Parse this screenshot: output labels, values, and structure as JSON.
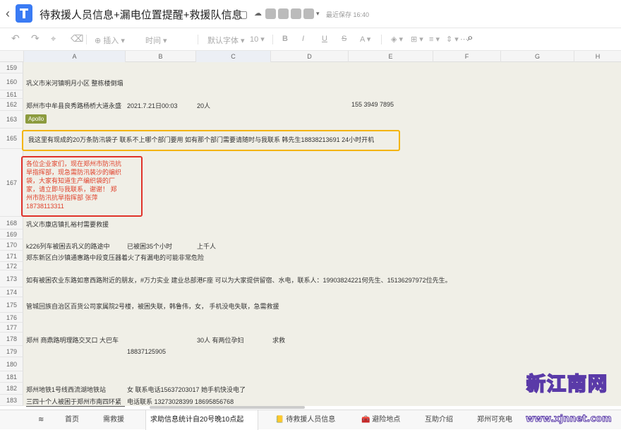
{
  "title": "待救援人员信息+漏电位置提醒+救援队信息",
  "save_status": "最近保存 16:40",
  "toolbar": {
    "undo": "↶",
    "redo": "↷",
    "paint": "⌖",
    "clear": "⌫",
    "insert": "⊕ 插入 ▾",
    "time": "时间 ▾",
    "font": "默认字体 ▾",
    "size": "10 ▾",
    "bold": "B",
    "italic": "I",
    "underline": "U",
    "strike": "S",
    "textcolor": "A ▾",
    "fill": "◈ ▾",
    "border": "⊞ ▾",
    "align": "≡ ▾",
    "valign": "⇕ ▾",
    "more": "⋯",
    "search": "⌕"
  },
  "columns": [
    "A",
    "B",
    "C",
    "D",
    "E",
    "F",
    "G",
    "H"
  ],
  "rows": [
    {
      "num": "159",
      "cells": []
    },
    {
      "num": "160",
      "cells": [
        {
          "col": "A",
          "text": "巩义市米河镇明月小区 整栋楼倒塌"
        }
      ]
    },
    {
      "num": "161",
      "cells": []
    },
    {
      "num": "162",
      "cells": [
        {
          "col": "A",
          "text": "郑州市中牟县良秀路杨桥大道永盛"
        },
        {
          "col": "B",
          "text": "2021.7.21日00:03"
        },
        {
          "col": "C",
          "text": "20人"
        },
        {
          "col": "E",
          "text": "155 3949 7895"
        }
      ]
    },
    {
      "num": "163",
      "cells": []
    },
    {
      "num": "165",
      "cells": [
        {
          "col": "A",
          "text": "我这里有现成的20万条防汛袋子 联系不上哪个部门要用 如有那个部门需要请随时与我联系 韩先生18838213691 24小时开机"
        }
      ]
    },
    {
      "num": "167",
      "cells": []
    },
    {
      "num": "168",
      "cells": [
        {
          "col": "A",
          "text": "巩义市康店镇扎裕村需要救援"
        }
      ]
    },
    {
      "num": "169",
      "cells": []
    },
    {
      "num": "170",
      "cells": [
        {
          "col": "A",
          "text": "k226列车被困去巩义的路途中"
        },
        {
          "col": "B",
          "text": "已被困35个小时"
        },
        {
          "col": "C",
          "text": "上千人"
        }
      ]
    },
    {
      "num": "171",
      "cells": [
        {
          "col": "A",
          "text": "郑东新区白沙镇通惠路中段变压器着火了有漏电的可能非常危险"
        }
      ]
    },
    {
      "num": "172",
      "cells": []
    },
    {
      "num": "173",
      "cells": [
        {
          "col": "A",
          "text": "如有被困农业东路如意西路附近的朋友，#万力实业 建业总部港F座 可以为大家提供留宿、水电，联系人：19903824221何先生、15136297972位先生。"
        }
      ]
    },
    {
      "num": "174",
      "cells": []
    },
    {
      "num": "175",
      "cells": [
        {
          "col": "A",
          "text": "管城回族自治区百货公司家属院2号楼，被困失联，韩鲁伟，女，  手机没电失联，急需救援"
        }
      ]
    },
    {
      "num": "176",
      "cells": []
    },
    {
      "num": "177",
      "cells": []
    },
    {
      "num": "178",
      "cells": [
        {
          "col": "A",
          "text": "郑州 商鼎路明理路交叉口 大巴车"
        },
        {
          "col": "C",
          "text": "30人 有两位孕妇"
        },
        {
          "col": "D",
          "text": "求救"
        }
      ]
    },
    {
      "num": "179",
      "cells": [
        {
          "col": "B",
          "text": "18837125905"
        }
      ]
    },
    {
      "num": "180",
      "cells": []
    },
    {
      "num": "181",
      "cells": []
    },
    {
      "num": "182",
      "cells": [
        {
          "col": "A",
          "text": "郑州地铁1号线西流湖地铁站"
        },
        {
          "col": "B",
          "text": "女  联系电话15637203017    她手机快没电了"
        }
      ]
    },
    {
      "num": "183",
      "cells": [
        {
          "col": "A",
          "text": "三四十个人被困于郑州市南四环紧"
        },
        {
          "col": "B",
          "text": "电话联系 13273028399   18695856768"
        }
      ]
    }
  ],
  "tag_label": "Apollo",
  "red_note": "各位企业家们，现在郑州市防汛抗旱指挥部，现急需防汛装沙的编织袋，大家有知道生产编织袋的厂家，请立即与我联系，谢谢！ 郑州市防汛抗旱指挥部 张萍18738113311",
  "tabs": [
    {
      "label": "≋",
      "active": false
    },
    {
      "label": "首页",
      "active": false
    },
    {
      "label": "需救援",
      "active": false
    },
    {
      "label": "求助信息统计自20号晚10点起",
      "active": true
    },
    {
      "label": "📒 待救援人员信息",
      "active": false
    },
    {
      "label": "🧰 避险地点",
      "active": false
    },
    {
      "label": "互助介绍",
      "active": false
    },
    {
      "label": "郑州可充电",
      "active": false
    }
  ],
  "watermark": {
    "logo": "新江南网",
    "url": "www.xjnnet.com"
  }
}
